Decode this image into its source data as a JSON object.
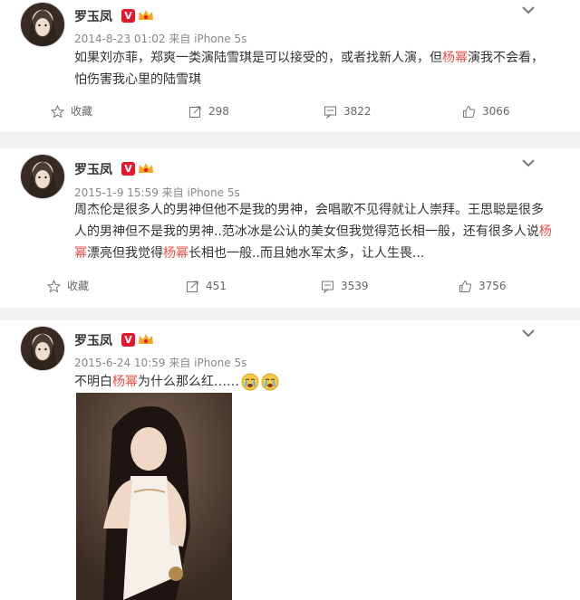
{
  "posts": [
    {
      "author": "罗玉凤",
      "verified": "V",
      "meta": "2014-8-23 01:02 来自 iPhone 5s",
      "content_parts": [
        {
          "text": "如果刘亦菲，郑爽一类演陆雪琪是可以接受的，或者找新人演，但",
          "hl": false
        },
        {
          "text": "杨幂",
          "hl": true
        },
        {
          "text": "演我不会看，怕伤害我心里的陆雪琪",
          "hl": false
        }
      ],
      "actions": {
        "collect": "收藏",
        "repost": "298",
        "comment": "3822",
        "like": "3066"
      }
    },
    {
      "author": "罗玉凤",
      "verified": "V",
      "meta": "2015-1-9 15:59 来自 iPhone 5s",
      "content_parts": [
        {
          "text": "周杰伦是很多人的男神但他不是我的男神，会唱歌不见得就让人崇拜。王思聪是很多人的男神但不是我的男神..范冰冰是公认的美女但我觉得范长相一般，还有很多人说",
          "hl": false
        },
        {
          "text": "杨幂",
          "hl": true
        },
        {
          "text": "漂亮但我觉得",
          "hl": false
        },
        {
          "text": "杨幂",
          "hl": true
        },
        {
          "text": "长相也一般..而且她水军太多，让人生畏...",
          "hl": false
        }
      ],
      "actions": {
        "collect": "收藏",
        "repost": "451",
        "comment": "3539",
        "like": "3756"
      }
    },
    {
      "author": "罗玉凤",
      "verified": "V",
      "meta": "2015-6-24 10:59 来自 iPhone 5s",
      "content_parts": [
        {
          "text": "不明白",
          "hl": false
        },
        {
          "text": "杨幂",
          "hl": true
        },
        {
          "text": "为什么那么红……",
          "hl": false
        }
      ]
    }
  ],
  "colors": {
    "highlight": "#eb4f4a",
    "meta": "#888888",
    "vbadge": "#e6162d",
    "divider": "#e6e6e6"
  },
  "icons": [
    "chevron-down-icon",
    "star-icon",
    "repost-icon",
    "comment-icon",
    "thumbs-up-icon",
    "crown-badge-icon",
    "crying-emoji-icon"
  ]
}
